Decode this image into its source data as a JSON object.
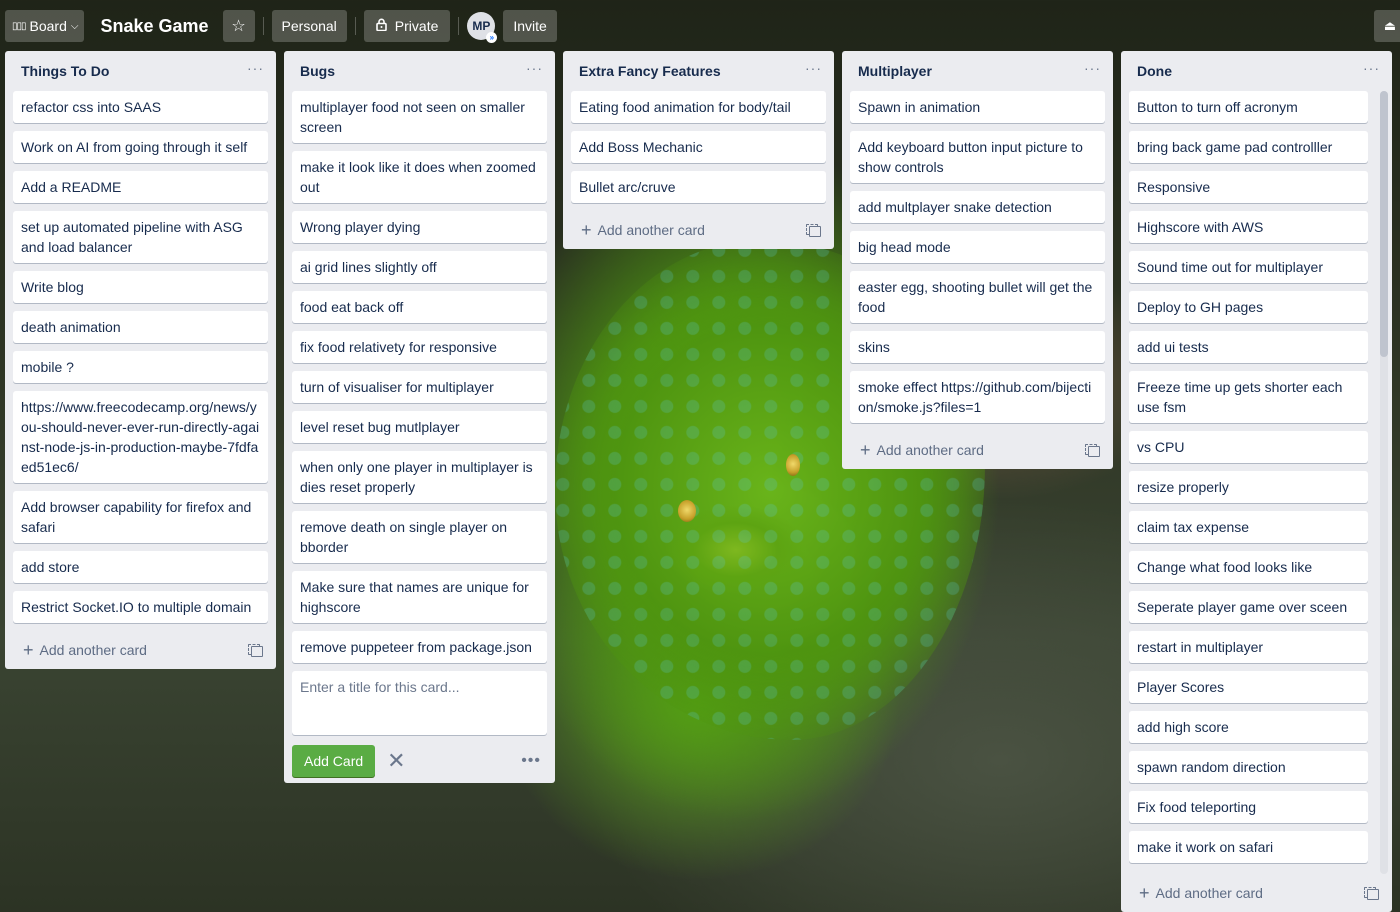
{
  "header": {
    "board_menu_label": "Board",
    "board_title": "Snake Game",
    "star_icon": "star-icon",
    "team_label": "Personal",
    "visibility_label": "Private",
    "avatar_initials": "MP",
    "invite_label": "Invite",
    "right_icon": "butler-icon"
  },
  "colors": {
    "list_bg": "#ebecf0",
    "card_text": "#172b4d",
    "add_button_green": "#5aac44"
  },
  "lists": [
    {
      "title": "Things To Do",
      "cards": [
        "refactor css into SAAS",
        "Work on AI from going through it self",
        "Add a README",
        "set up automated pipeline with ASG and load balancer",
        "Write blog",
        "death animation",
        "mobile ?",
        "https://www.freecodecamp.org/news/you-should-never-ever-run-directly-against-node-js-in-production-maybe-7fdfaed51ec6/",
        "Add browser capability for firefox and safari",
        "add store",
        "Restrict Socket.IO to multiple domain"
      ],
      "add_card_label": "Add another card"
    },
    {
      "title": "Bugs",
      "cards": [
        "multiplayer food not seen on smaller screen",
        "make it look like it does when zoomed out",
        "Wrong player dying",
        "ai grid lines slightly off",
        "food eat back off",
        "fix food relativety for responsive",
        "turn of visualiser for multiplayer",
        "level reset bug mutlplayer",
        "when only one player in multiplayer is dies reset properly",
        "remove death on single player on bborder",
        "Make sure that names are unique for highscore",
        "remove puppeteer from package.json"
      ],
      "composer": {
        "placeholder": "Enter a title for this card...",
        "value": "",
        "submit_label": "Add Card"
      }
    },
    {
      "title": "Extra Fancy Features",
      "cards": [
        "Eating food animation for body/tail",
        "Add Boss Mechanic",
        "Bullet arc/cruve"
      ],
      "add_card_label": "Add another card"
    },
    {
      "title": "Multiplayer",
      "cards": [
        "Spawn in animation",
        "Add keyboard button input picture to show controls",
        "add multplayer snake detection",
        "big head mode",
        "easter egg, shooting bullet will get the food",
        "skins",
        "smoke effect https://github.com/bijection/smoke.js?files=1"
      ],
      "add_card_label": "Add another card"
    },
    {
      "title": "Done",
      "cards": [
        "Button to turn off acronym",
        "bring back game pad controlller",
        "Responsive",
        "Highscore with AWS",
        "Sound time out for multiplayer",
        "Deploy to GH pages",
        "add ui tests",
        "Freeze time up gets shorter each use fsm",
        "vs CPU",
        "resize properly",
        "claim tax expense",
        "Change what food looks like",
        "Seperate player game over sceen",
        "restart in multiplayer",
        "Player Scores",
        "add high score",
        "spawn random direction",
        "Fix food teleporting",
        "make it work on safari"
      ],
      "add_card_label": "Add another card"
    }
  ]
}
